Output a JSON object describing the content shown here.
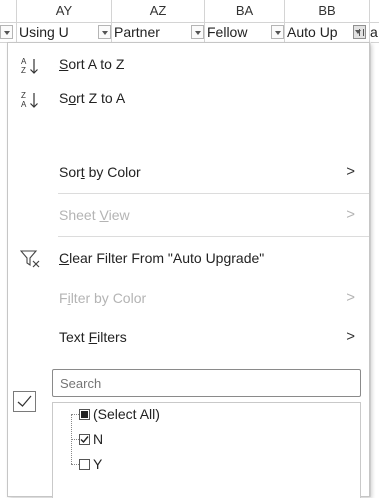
{
  "sheet": {
    "columns": [
      "AY",
      "AZ",
      "BA",
      "BB"
    ],
    "filter_headers": [
      "Using U",
      "Partner",
      "Fellow",
      "Auto Up",
      "a"
    ]
  },
  "menu": {
    "sort_az": {
      "prefix": "",
      "accel": "S",
      "suffix": "ort A to Z"
    },
    "sort_za": {
      "prefix": "S",
      "accel": "o",
      "suffix": "rt Z to A"
    },
    "sort_color": {
      "prefix": "Sor",
      "accel": "t",
      "suffix": " by Color"
    },
    "sheet_view": {
      "prefix": "Sheet ",
      "accel": "V",
      "suffix": "iew"
    },
    "clear_filter": {
      "prefix": "",
      "accel": "C",
      "suffix": "lear Filter From \"Auto Upgrade\""
    },
    "filter_color": {
      "prefix": "F",
      "accel": "i",
      "suffix": "lter by Color"
    },
    "text_filters": {
      "prefix": "Text ",
      "accel": "F",
      "suffix": "ilters"
    },
    "submenu_arrow": ">",
    "search_placeholder": "Search",
    "values": [
      {
        "label": "(Select All)",
        "state": "partial"
      },
      {
        "label": "N",
        "state": "checked"
      },
      {
        "label": "Y",
        "state": "unchecked"
      }
    ]
  },
  "colors": {
    "accent_border": "#c6c6c6",
    "disabled_text": "#b4b4b4"
  }
}
